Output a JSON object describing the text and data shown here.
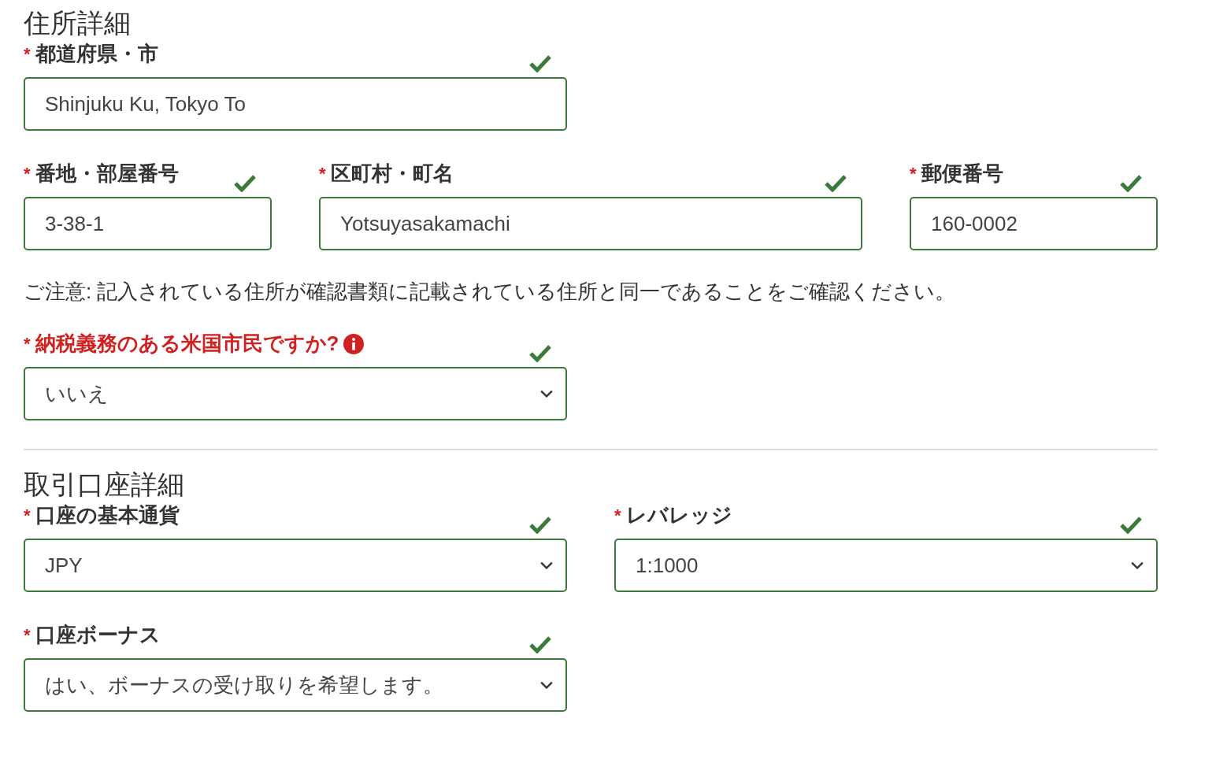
{
  "sections": [
    {
      "title": "住所詳細",
      "rows": [
        {
          "kind": "fields",
          "fields": [
            {
              "kind": "input",
              "marker": "*",
              "label": "都道府県・市",
              "value": "Shinjuku Ku, Tokyo To",
              "valid": true,
              "emphasis": false,
              "info": false
            }
          ]
        },
        {
          "kind": "fields",
          "fields": [
            {
              "kind": "input",
              "marker": "*",
              "label": "番地・部屋番号",
              "value": "3-38-1",
              "valid": true,
              "emphasis": false,
              "info": false
            },
            {
              "kind": "input",
              "marker": "*",
              "label": "区町村・町名",
              "value": "Yotsuyasakamachi",
              "valid": true,
              "emphasis": false,
              "info": false
            },
            {
              "kind": "input",
              "marker": "*",
              "label": "郵便番号",
              "value": "160-0002",
              "valid": true,
              "emphasis": false,
              "info": false
            }
          ]
        },
        {
          "kind": "note",
          "text": "ご注意: 記入されている住所が確認書類に記載されている住所と同一であることをご確認ください。"
        },
        {
          "kind": "fields",
          "fields": [
            {
              "kind": "select",
              "marker": "*",
              "label": "納税義務のある米国市民ですか?",
              "value": "いいえ",
              "valid": true,
              "emphasis": true,
              "info": true
            }
          ]
        }
      ]
    },
    {
      "title": "取引口座詳細",
      "rows": [
        {
          "kind": "fields",
          "fields": [
            {
              "kind": "select",
              "marker": "*",
              "label": "口座の基本通貨",
              "value": "JPY",
              "valid": true,
              "emphasis": false,
              "info": false
            },
            {
              "kind": "select",
              "marker": "*",
              "label": "レバレッジ",
              "value": "1:1000",
              "valid": true,
              "emphasis": false,
              "info": false
            }
          ]
        },
        {
          "kind": "fields",
          "fields": [
            {
              "kind": "select",
              "marker": "*",
              "label": "口座ボーナス",
              "value": "はい、ボーナスの受け取りを希望します。",
              "valid": true,
              "emphasis": false,
              "info": false
            }
          ]
        }
      ]
    }
  ]
}
